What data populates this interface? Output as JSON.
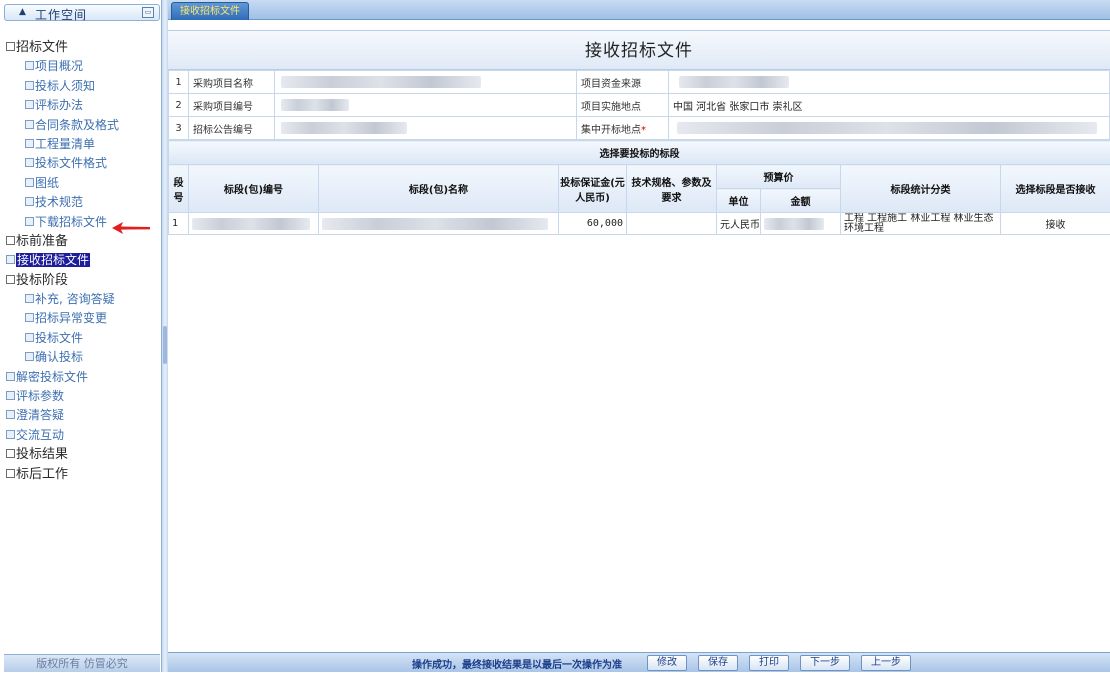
{
  "sidebar": {
    "title": "工作空间",
    "footer": "版权所有 仿冒必究",
    "items": [
      {
        "label": "招标文件",
        "type": "group"
      },
      {
        "label": "项目概况",
        "type": "sub"
      },
      {
        "label": "投标人须知",
        "type": "sub"
      },
      {
        "label": "评标办法",
        "type": "sub"
      },
      {
        "label": "合同条款及格式",
        "type": "sub"
      },
      {
        "label": "工程量清单",
        "type": "sub"
      },
      {
        "label": "投标文件格式",
        "type": "sub"
      },
      {
        "label": "图纸",
        "type": "sub"
      },
      {
        "label": "技术规范",
        "type": "sub"
      },
      {
        "label": "下载招标文件",
        "type": "sub"
      },
      {
        "label": "标前准备",
        "type": "group"
      },
      {
        "label": "接收招标文件",
        "type": "top",
        "selected": true
      },
      {
        "label": "投标阶段",
        "type": "group"
      },
      {
        "label": "补充, 咨询答疑",
        "type": "sub"
      },
      {
        "label": "招标异常变更",
        "type": "sub"
      },
      {
        "label": "投标文件",
        "type": "sub"
      },
      {
        "label": "确认投标",
        "type": "sub"
      },
      {
        "label": "解密投标文件",
        "type": "top"
      },
      {
        "label": "评标参数",
        "type": "top"
      },
      {
        "label": "澄清答疑",
        "type": "top"
      },
      {
        "label": "交流互动",
        "type": "top"
      },
      {
        "label": "投标结果",
        "type": "group"
      },
      {
        "label": "标后工作",
        "type": "group"
      }
    ]
  },
  "tab": {
    "label": "接收招标文件"
  },
  "page": {
    "title": "接收招标文件"
  },
  "info": {
    "rows": [
      {
        "num": "1",
        "label": "采购项目名称",
        "label2": "项目资金来源",
        "value2": "",
        "required": false
      },
      {
        "num": "2",
        "label": "采购项目编号",
        "label2": "项目实施地点",
        "value2": "中国 河北省 张家口市 崇礼区",
        "required": false
      },
      {
        "num": "3",
        "label": "招标公告编号",
        "label2": "集中开标地点",
        "value2": "",
        "required": true
      }
    ],
    "required_mark": "*"
  },
  "bid_table": {
    "caption": "选择要投标的标段",
    "headers": {
      "seq": "段号",
      "code": "标段(包)编号",
      "name": "标段(包)名称",
      "deposit": "投标保证金(元人民币)",
      "tech": "技术规格、参数及要求",
      "budget": "预算价",
      "unit": "单位",
      "amount": "金额",
      "category": "标段统计分类",
      "receive": "选择标段是否接收"
    },
    "rows": [
      {
        "seq": "1",
        "deposit": "60,000",
        "tech": "",
        "unit": "元人民币",
        "category": "工程 工程施工 林业工程 林业生态环境工程",
        "receive": "接收"
      }
    ]
  },
  "bottom": {
    "status": "操作成功，最终接收结果是以最后一次操作为准",
    "buttons": {
      "modify": "修改",
      "save": "保存",
      "print": "打印",
      "next": "下一步",
      "prev": "上一步"
    }
  },
  "colors": {
    "selected_bg": "#1d1d9b",
    "tab_text": "#ffe66a",
    "arrow": "#e02020",
    "status_text": "#1c3f8a"
  }
}
